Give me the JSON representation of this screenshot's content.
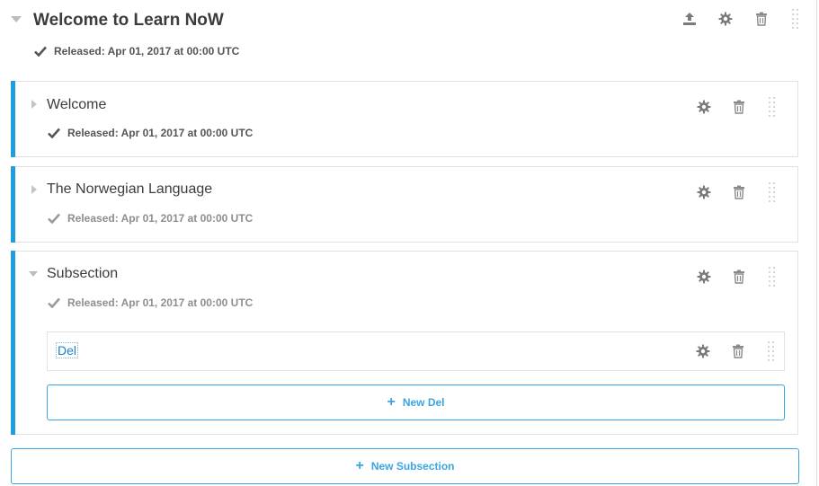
{
  "section": {
    "title": "Welcome to Learn NoW",
    "status": "Released: Apr 01, 2017 at 00:00 UTC"
  },
  "subsections": [
    {
      "title": "Welcome",
      "status": "Released: Apr 01, 2017 at 00:00 UTC",
      "expanded": false
    },
    {
      "title": "The Norwegian Language",
      "status": "Released: Apr 01, 2017 at 00:00 UTC",
      "expanded": false
    },
    {
      "title": "Subsection",
      "status": "Released: Apr 01, 2017 at 00:00 UTC",
      "expanded": true
    }
  ],
  "unit": {
    "title": "Del"
  },
  "buttons": {
    "new_unit": "New Del",
    "new_subsection": "New Subsection"
  },
  "colors": {
    "accent": "#1e9ee0",
    "link": "#1b82c4",
    "button": "#3aa5e2"
  }
}
